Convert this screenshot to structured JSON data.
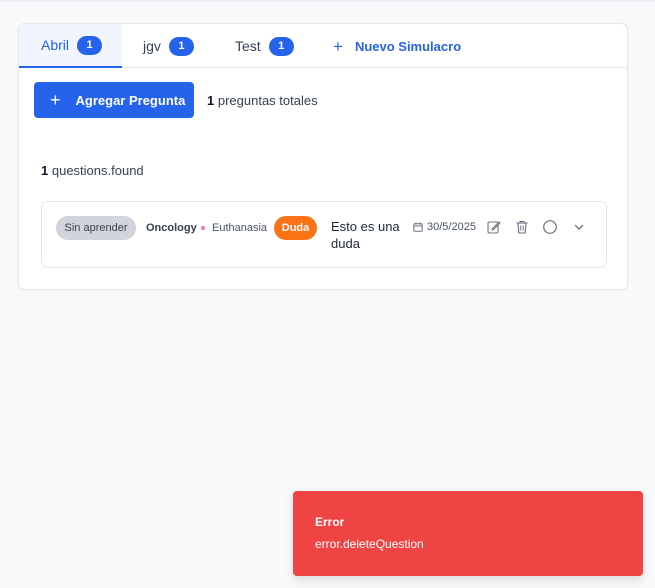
{
  "tabs": [
    {
      "label": "Abril",
      "count": "1",
      "active": true
    },
    {
      "label": "jgv",
      "count": "1",
      "active": false
    },
    {
      "label": "Test",
      "count": "1",
      "active": false
    }
  ],
  "new_tab_label": "Nuevo Simulacro",
  "toolbar": {
    "add_label": "Agregar Pregunta",
    "total_count": "1",
    "total_text": "preguntas totales"
  },
  "results": {
    "count": "1",
    "text": "questions.found"
  },
  "question": {
    "status": "Sin aprender",
    "subject": "Oncology",
    "topic": "Euthanasia",
    "tag": "Duda",
    "text": "Esto es una duda",
    "date": "30/5/2025"
  },
  "icons": [
    "plus-icon",
    "calendar-icon",
    "edit-icon",
    "trash-icon",
    "circle-icon",
    "chevron-down-icon"
  ],
  "colors": {
    "accent": "#2563eb",
    "duda_tag": "#f97316",
    "status_pill": "#d1d5db",
    "toast_error": "#ef4444",
    "topic_dot": "#f472b6"
  },
  "toast": {
    "title": "Error",
    "message": "error.deleteQuestion"
  }
}
